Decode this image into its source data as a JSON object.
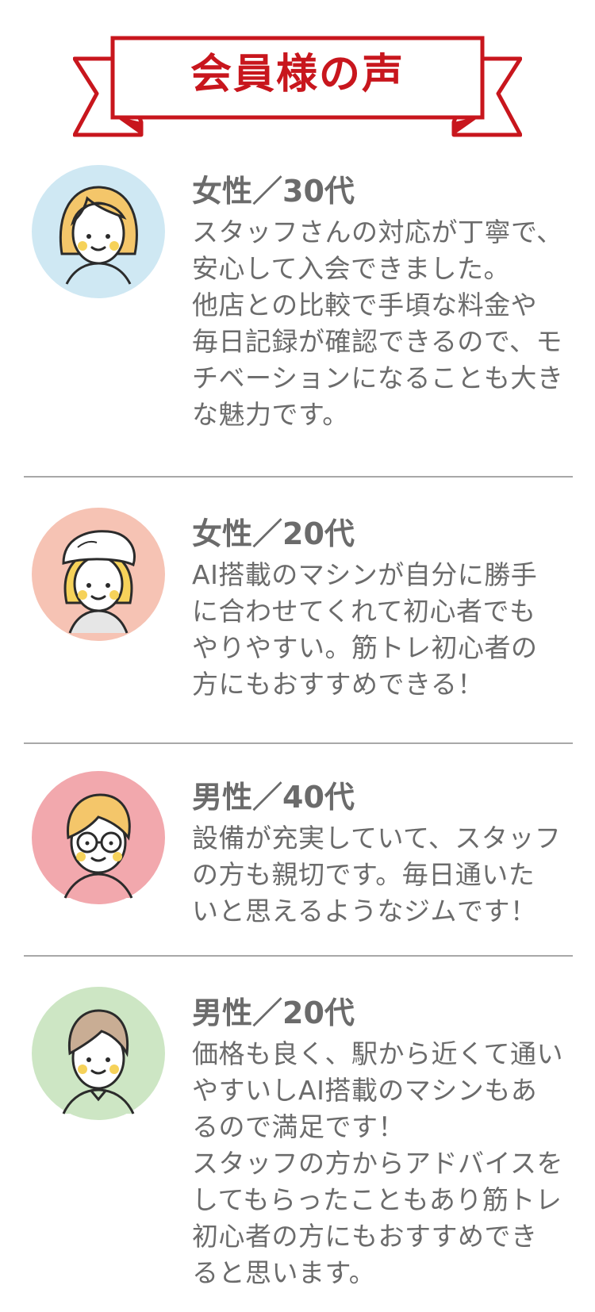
{
  "header": {
    "title": "会員様の声"
  },
  "testimonials": [
    {
      "label": "女性／30代",
      "comment": "スタッフさんの対応が丁寧で、\n安心して入会できました。\n他店との比較で手頃な料金や\n毎日記録が確認できるので、モ\nチベーションになることも大き\nな魅力です。"
    },
    {
      "label": "女性／20代",
      "comment": "AI搭載のマシンが自分に勝手\nに合わせてくれて初心者でも\nやりやすい。筋トレ初心者の\n方にもおすすめできる！"
    },
    {
      "label": "男性／40代",
      "comment": "設備が充実していて、スタッフ\nの方も親切です。毎日通いた\nいと思えるようなジムです！"
    },
    {
      "label": "男性／20代",
      "comment": "価格も良く、駅から近くて通い\nやすいしAI搭載のマシンもあ\nるので満足です！\nスタッフの方からアドバイスを\nしてもらったこともあり筋トレ\n初心者の方にもおすすめでき\nると思います。"
    }
  ],
  "colors": {
    "brand_red": "#c8161d",
    "text_gray": "#6b6b6b",
    "avatar_bg_1": "#cfe8f3",
    "avatar_bg_2": "#f6c3b4",
    "avatar_bg_3": "#f2a8ad",
    "avatar_bg_4": "#cde6c4"
  },
  "icons": [
    "woman-avatar-icon",
    "woman-cap-avatar-icon",
    "man-glasses-avatar-icon",
    "man-avatar-icon",
    "ribbon-banner-icon"
  ]
}
